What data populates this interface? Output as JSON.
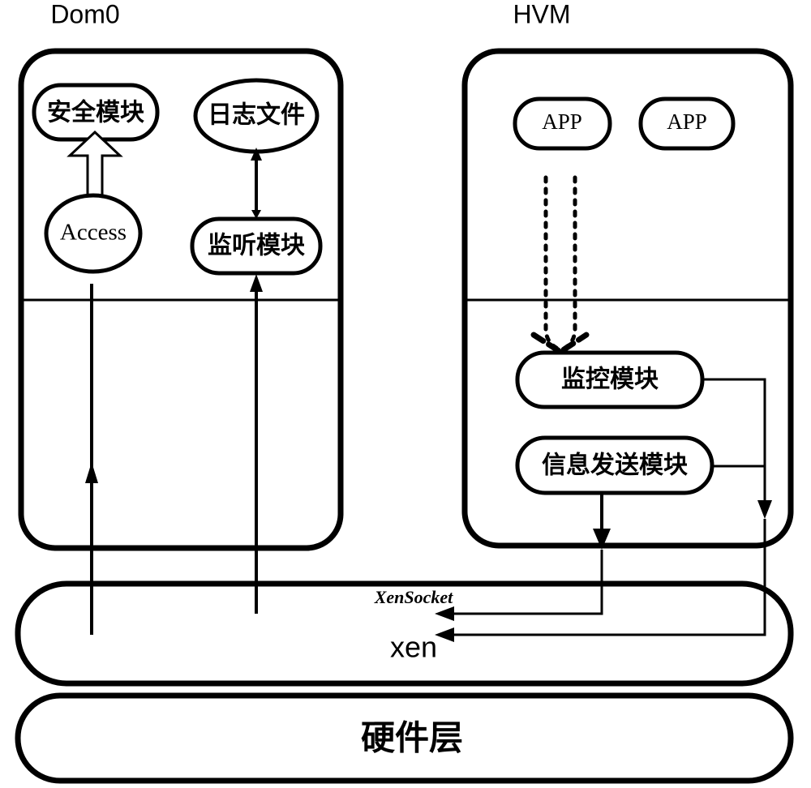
{
  "diagram": {
    "title_dom0": "Dom0",
    "title_hvm": "HVM",
    "dom0": {
      "nodes": [
        {
          "id": "security-module",
          "label": "安全模块"
        },
        {
          "id": "log-file",
          "label": "日志文件"
        },
        {
          "id": "access",
          "label": "Access"
        },
        {
          "id": "listen-module",
          "label": "监听模块"
        }
      ]
    },
    "hvm": {
      "nodes": [
        {
          "id": "app-1",
          "label": "APP"
        },
        {
          "id": "app-2",
          "label": "APP"
        },
        {
          "id": "monitor-module",
          "label": "监控模块"
        },
        {
          "id": "info-send-module",
          "label": "信息发送模块"
        }
      ]
    },
    "layers": [
      {
        "id": "xen-layer",
        "label": "xen",
        "annotation": "XenSocket"
      },
      {
        "id": "hardware-layer",
        "label": "硬件层"
      }
    ],
    "colors": {
      "stroke": "#000000",
      "fill": "#ffffff",
      "background": "#ffffff"
    }
  }
}
